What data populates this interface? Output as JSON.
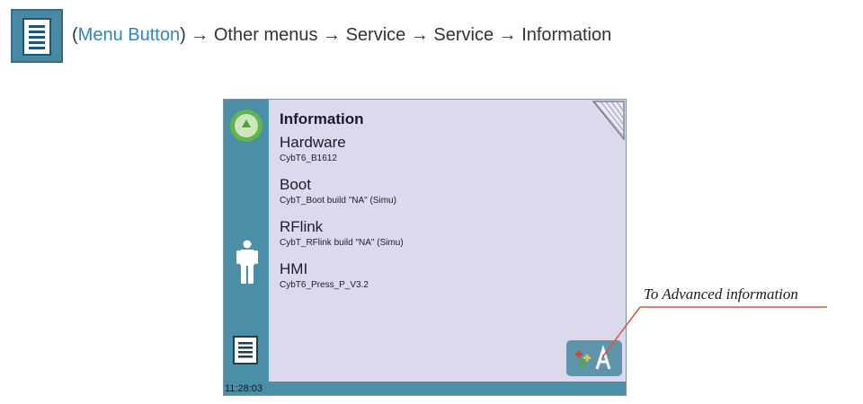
{
  "breadcrumb": {
    "open_paren": "(",
    "menu_button": "Menu Button",
    "rest": ") → Other menus → Service → Service → Information"
  },
  "screen": {
    "title": "Information",
    "items": [
      {
        "name": "Hardware",
        "value": "CybT6_B1612"
      },
      {
        "name": "Boot",
        "value": "CybT_Boot build \"NA\" (Simu)"
      },
      {
        "name": "RFlink",
        "value": "CybT_RFlink build \"NA\" (Simu)"
      },
      {
        "name": "HMI",
        "value": "CybT6_Press_P_V3.2"
      }
    ],
    "clock": "11:28:03"
  },
  "annotation": {
    "label": "To Advanced information"
  },
  "colors": {
    "panel": "#4b8fa6",
    "screen_bg": "#dcd9ec",
    "home_green": "#62b548",
    "link": "#2e86b8",
    "annotation_line": "#d9533a"
  },
  "icons": {
    "menu": "menu-list-icon",
    "home": "home-icon",
    "person": "person-icon",
    "corner": "corner-fold-icon",
    "advanced": "advanced-settings-icon"
  }
}
